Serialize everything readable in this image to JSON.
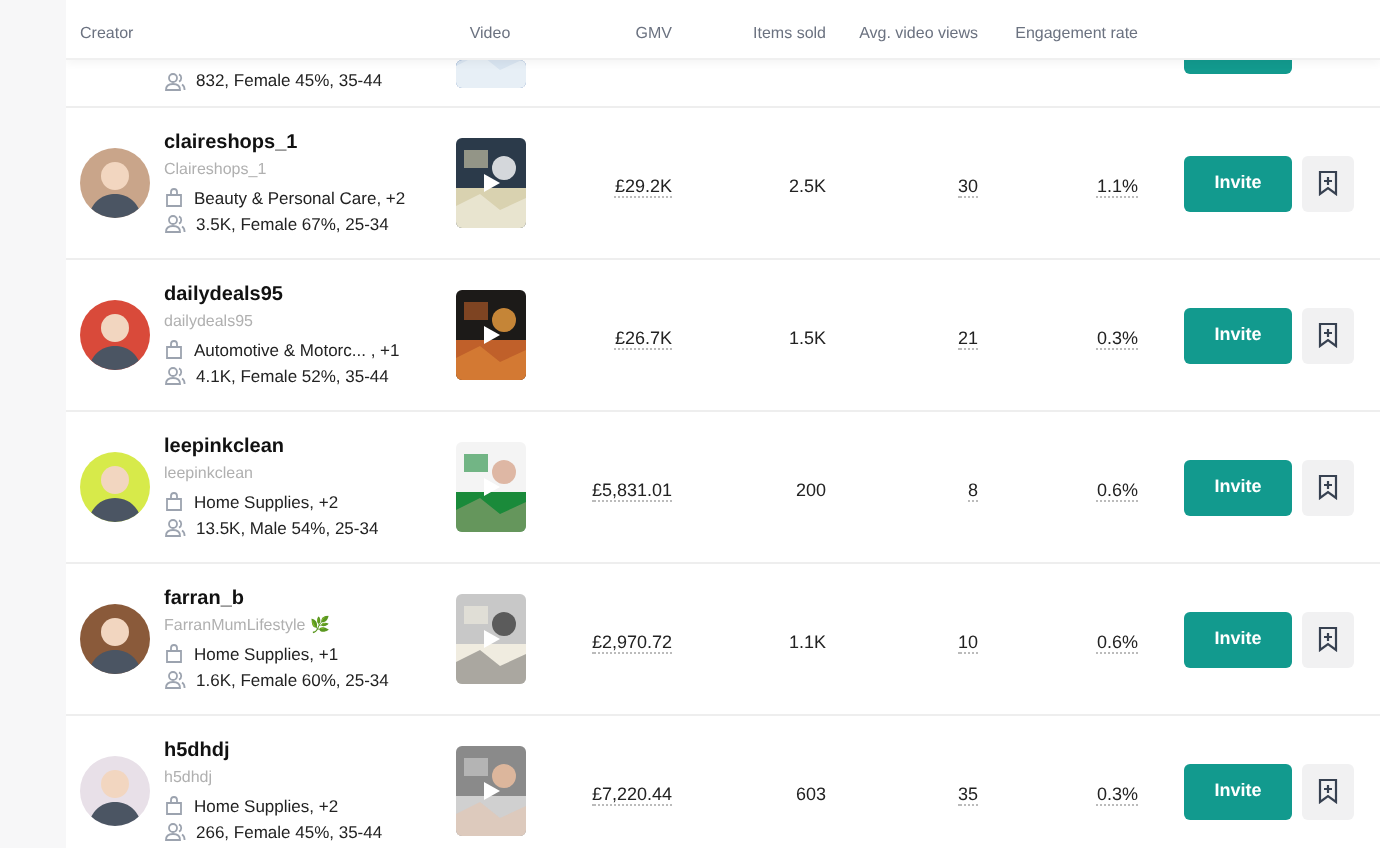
{
  "table": {
    "columns": [
      "Creator",
      "Video",
      "GMV",
      "Items sold",
      "Avg. video views",
      "Engagement rate"
    ],
    "partial_row": {
      "audience": "832, Female 45%, 35-44"
    },
    "rows": [
      {
        "name": "claireshops_1",
        "handle": "Claireshops_1",
        "categories": "Beauty & Personal Care, +2",
        "audience": "3.5K, Female 67%, 25-34",
        "gmv": "£29.2K",
        "items_sold": "2.5K",
        "views": "30",
        "engagement": "1.1%",
        "action": "Invite"
      },
      {
        "name": "dailydeals95",
        "handle": "dailydeals95",
        "categories": "Automotive & Motorc... , +1",
        "audience": "4.1K, Female 52%, 35-44",
        "gmv": "£26.7K",
        "items_sold": "1.5K",
        "views": "21",
        "engagement": "0.3%",
        "action": "Invite"
      },
      {
        "name": "leepinkclean",
        "handle": "leepinkclean",
        "categories": "Home Supplies, +2",
        "audience": "13.5K, Male 54%, 25-34",
        "gmv": "£5,831.01",
        "items_sold": "200",
        "views": "8",
        "engagement": "0.6%",
        "action": "Invite"
      },
      {
        "name": "farran_b",
        "handle": "FarranMumLifestyle 🌿",
        "categories": "Home Supplies, +1",
        "audience": "1.6K, Female 60%, 25-34",
        "gmv": "£2,970.72",
        "items_sold": "1.1K",
        "views": "10",
        "engagement": "0.6%",
        "action": "Invite"
      },
      {
        "name": "h5dhdj",
        "handle": "h5dhdj",
        "categories": "Home Supplies, +2",
        "audience": "266, Female 45%, 35-44",
        "gmv": "£7,220.44",
        "items_sold": "603",
        "views": "35",
        "engagement": "0.3%",
        "action": "Invite"
      }
    ]
  }
}
